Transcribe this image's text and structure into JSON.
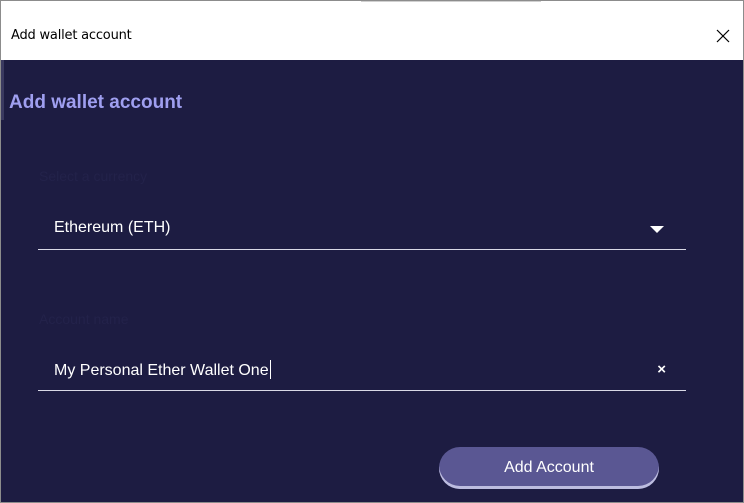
{
  "window": {
    "title": "Add wallet account"
  },
  "page": {
    "title": "Add wallet account"
  },
  "currency": {
    "label": "Select a currency",
    "value": "Ethereum (ETH)"
  },
  "account_name": {
    "label": "Account name",
    "value": "My Personal Ether Wallet One",
    "clear_glyph": "×"
  },
  "actions": {
    "add_label": "Add Account"
  },
  "colors": {
    "background": "#1d1c42",
    "title": "#9f9ff0",
    "button": "#5a5793"
  }
}
